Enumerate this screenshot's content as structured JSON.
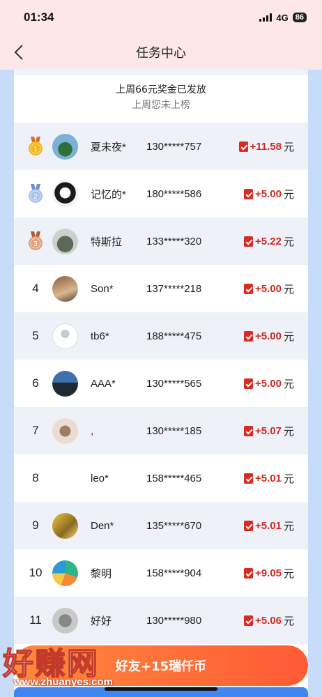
{
  "status_bar": {
    "time": "01:34",
    "network": "4G",
    "battery": "86"
  },
  "nav": {
    "title": "任务中心"
  },
  "summary": {
    "title": "上周66元奖金已发放",
    "subtitle": "上周您未上榜"
  },
  "rows": [
    {
      "rank": "1",
      "medal": "gold",
      "name": "夏未夜*",
      "phone": "130*****757",
      "amount": "+11.58",
      "unit": "元"
    },
    {
      "rank": "2",
      "medal": "silver",
      "name": "记忆的*",
      "phone": "180*****586",
      "amount": "+5.00",
      "unit": "元"
    },
    {
      "rank": "3",
      "medal": "bronze",
      "name": "特斯拉",
      "phone": "133*****320",
      "amount": "+5.22",
      "unit": "元"
    },
    {
      "rank": "4",
      "name": "Son*",
      "phone": "137*****218",
      "amount": "+5.00",
      "unit": "元"
    },
    {
      "rank": "5",
      "name": "tb6*",
      "phone": "188*****475",
      "amount": "+5.00",
      "unit": "元"
    },
    {
      "rank": "6",
      "name": "AAA*",
      "phone": "130*****565",
      "amount": "+5.00",
      "unit": "元"
    },
    {
      "rank": "7",
      "name": ",",
      "phone": "130*****185",
      "amount": "+5.07",
      "unit": "元"
    },
    {
      "rank": "8",
      "name": "leo*",
      "phone": "158*****465",
      "amount": "+5.01",
      "unit": "元"
    },
    {
      "rank": "9",
      "name": "Den*",
      "phone": "135*****670",
      "amount": "+5.01",
      "unit": "元"
    },
    {
      "rank": "10",
      "name": "黎明",
      "phone": "158*****904",
      "amount": "+9.05",
      "unit": "元"
    },
    {
      "rank": "11",
      "name": "好好",
      "phone": "130*****980",
      "amount": "+5.06",
      "unit": "元"
    }
  ],
  "invite_button": {
    "label": "好友+15瑞仟币"
  },
  "watermark": {
    "text": "好赚网",
    "url": "www.zhuanyes.com"
  },
  "colors": {
    "accent_red": "#d02a20",
    "header_pink": "#fde7e9",
    "page_blue": "#c7dcf8",
    "cta_orange": "#ff6a38"
  }
}
